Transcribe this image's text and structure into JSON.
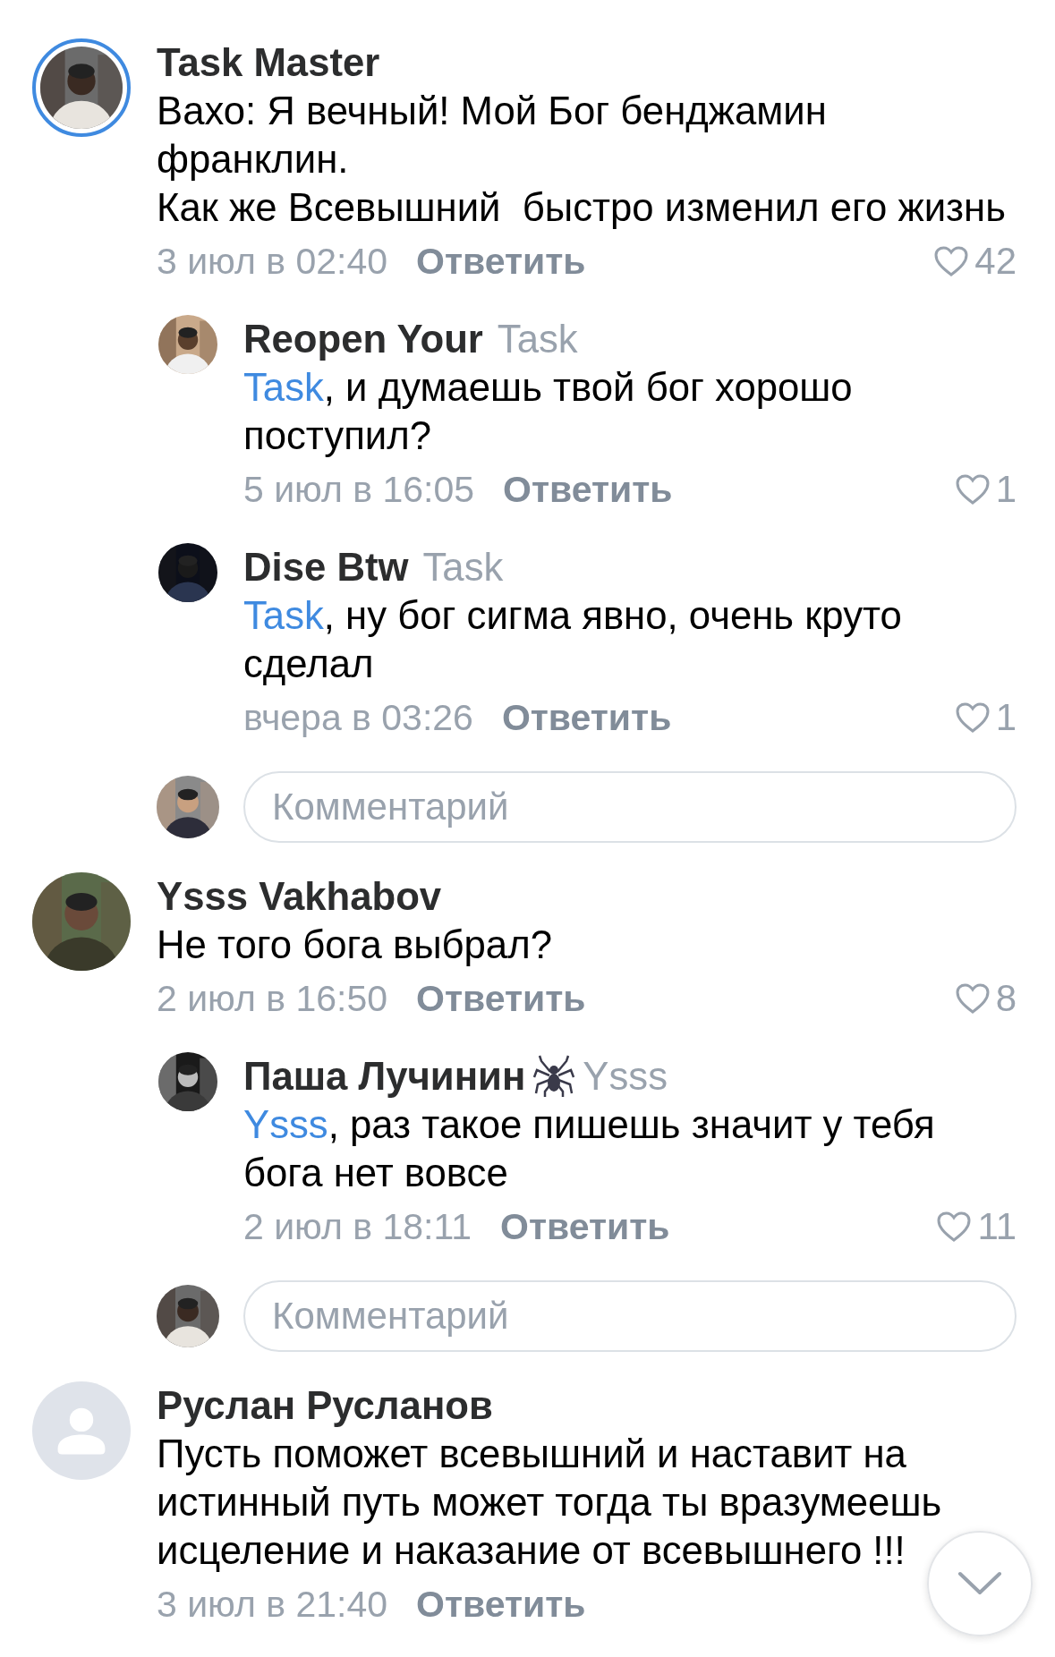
{
  "comments": [
    {
      "author": "Task Master",
      "avatar": {
        "kind": "picture",
        "story_ring": true
      },
      "text": "Вахо: Я вечный! Мой Бог бенджамин франклин.\nКак же Всевышний  быстро изменил его жизнь",
      "date": "3 июл в 02:40",
      "reply_label": "Ответить",
      "likes": "42",
      "replies": [
        {
          "author": "Reopen Your",
          "reply_to": "Task",
          "avatar": {
            "kind": "picture"
          },
          "mention": "Task",
          "text": ", и думаешь твой бог хорошо поступил?",
          "date": "5 июл в 16:05",
          "reply_label": "Ответить",
          "likes": "1"
        },
        {
          "author": "Dise Btw",
          "reply_to": "Task",
          "avatar": {
            "kind": "picture"
          },
          "mention": "Task",
          "text": ", ну бог сигма явно, очень круто сделал",
          "date": "вчера в 03:26",
          "reply_label": "Ответить",
          "likes": "1"
        }
      ],
      "comment_input": {
        "placeholder": "Комментарий"
      }
    },
    {
      "author": "Ysss Vakhabov",
      "avatar": {
        "kind": "picture"
      },
      "text": "Не того бога выбрал?",
      "date": "2 июл в 16:50",
      "reply_label": "Ответить",
      "likes": "8",
      "replies": [
        {
          "author": "Паша Лучинин",
          "spider_badge": true,
          "reply_to": "Ysss",
          "avatar": {
            "kind": "picture"
          },
          "mention": "Ysss",
          "text": ", раз такое пишешь значит у тебя бога нет вовсе",
          "date": "2 июл в 18:11",
          "reply_label": "Ответить",
          "likes": "11"
        }
      ],
      "comment_input": {
        "placeholder": "Комментарий"
      }
    },
    {
      "author": "Руслан Русланов",
      "avatar": {
        "kind": "placeholder"
      },
      "text": "Пусть поможет всевышний и наставит на истинный путь может тогда ты вразумеешь исцеление и наказание от всевышнего !!!",
      "date": "3 июл в 21:40",
      "reply_label": "Ответить"
    }
  ],
  "scroll_down_button": {
    "visible": true
  }
}
